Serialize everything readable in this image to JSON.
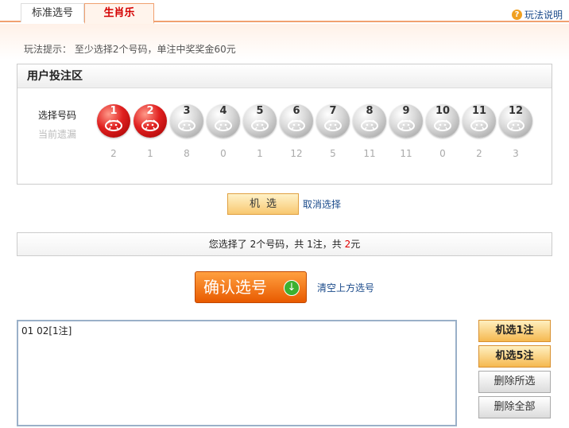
{
  "tabs": [
    {
      "label": "标准选号",
      "active": false
    },
    {
      "label": "生肖乐",
      "active": true
    }
  ],
  "help": {
    "label": "玩法说明"
  },
  "tip": "玩法提示： 至少选择2个号码，单注中奖奖金60元",
  "bet_area": {
    "title": "用户投注区",
    "select_label": "选择号码",
    "miss_label": "当前遗漏",
    "balls": [
      {
        "num": "1",
        "miss": "2",
        "selected": true,
        "zodiac": "rat"
      },
      {
        "num": "2",
        "miss": "1",
        "selected": true,
        "zodiac": "ox"
      },
      {
        "num": "3",
        "miss": "8",
        "selected": false,
        "zodiac": "tiger"
      },
      {
        "num": "4",
        "miss": "0",
        "selected": false,
        "zodiac": "rabbit"
      },
      {
        "num": "5",
        "miss": "1",
        "selected": false,
        "zodiac": "dragon"
      },
      {
        "num": "6",
        "miss": "12",
        "selected": false,
        "zodiac": "snake"
      },
      {
        "num": "7",
        "miss": "5",
        "selected": false,
        "zodiac": "horse"
      },
      {
        "num": "8",
        "miss": "11",
        "selected": false,
        "zodiac": "goat"
      },
      {
        "num": "9",
        "miss": "11",
        "selected": false,
        "zodiac": "monkey"
      },
      {
        "num": "10",
        "miss": "0",
        "selected": false,
        "zodiac": "rooster"
      },
      {
        "num": "11",
        "miss": "2",
        "selected": false,
        "zodiac": "dog"
      },
      {
        "num": "12",
        "miss": "3",
        "selected": false,
        "zodiac": "pig"
      }
    ]
  },
  "random_button": "机选",
  "cancel_link": "取消选择",
  "summary": {
    "prefix": "您选择了",
    "count": "2",
    "mid1": "个号码，共",
    "bets": "1",
    "mid2": "注，共",
    "amount": "2",
    "suffix": "元"
  },
  "confirm_button": "确认选号",
  "clear_link": "清空上方选号",
  "bet_list": [
    "01 02[1注]"
  ],
  "side_buttons": [
    {
      "label": "机选1注",
      "style": "orange"
    },
    {
      "label": "机选5注",
      "style": "orange"
    },
    {
      "label": "删除所选",
      "style": "gray"
    },
    {
      "label": "删除全部",
      "style": "gray"
    }
  ],
  "colors": {
    "accent": "#e85a00",
    "selected_ball": "#e02020",
    "link": "#1a4a8a"
  }
}
